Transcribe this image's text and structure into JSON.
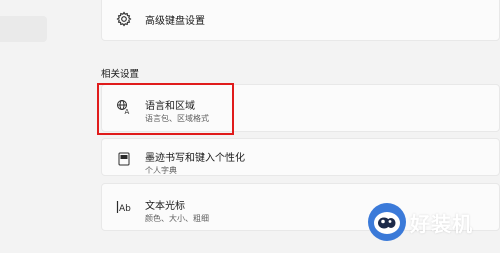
{
  "top_card": {
    "label": "高级键盘设置",
    "icon": "gear-icon"
  },
  "section": {
    "label": "相关设置"
  },
  "related_items": [
    {
      "title": "语言和区域",
      "subtitle": "语言包、区域格式",
      "icon": "language-icon"
    },
    {
      "title": "墨迹书写和键入个性化",
      "subtitle": "个人字典",
      "icon": "notebook-icon"
    },
    {
      "title": "文本光标",
      "subtitle": "颜色、大小、粗细",
      "icon": "text-cursor-icon"
    }
  ],
  "highlight": {
    "color": "#e01b1b"
  },
  "watermark": {
    "text": "好装机"
  }
}
